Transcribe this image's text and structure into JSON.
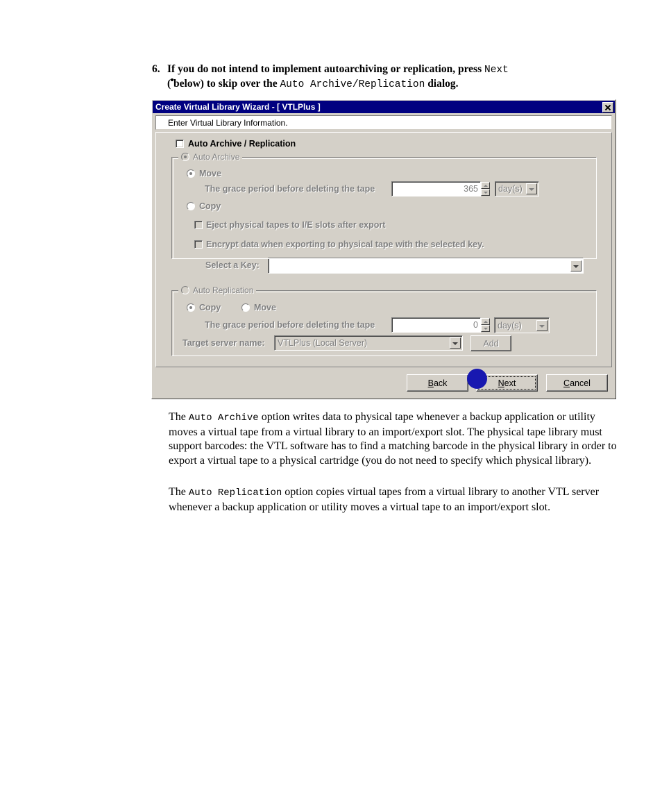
{
  "step": {
    "number": "6.",
    "line1_a": "If you do not intend to implement autoarchiving or replication, press ",
    "line1_mono": "Next",
    "line2_a": "(",
    "line2_b": " below) to skip over the ",
    "line2_mono": "Auto Archive/Replication",
    "line2_c": " dialog."
  },
  "dialog": {
    "title": "Create Virtual Library Wizard - [ VTLPlus ]",
    "close_icon": "close-icon",
    "subheader": "Enter Virtual Library Information.",
    "main_checkbox_label": "Auto Archive / Replication",
    "auto_archive": {
      "legend": "Auto Archive",
      "move_label": "Move",
      "copy_label": "Copy",
      "grace_label": "The grace period before deleting the tape",
      "grace_value": "365",
      "grace_unit": "day(s)",
      "eject_label": "Eject physical tapes to I/E slots after export",
      "encrypt_label": "Encrypt data when exporting to physical tape with the selected key.",
      "select_key_label": "Select a Key:",
      "select_key_value": ""
    },
    "auto_replication": {
      "legend": "Auto Replication",
      "copy_label": "Copy",
      "move_label": "Move",
      "grace_label": "The grace period before deleting the tape",
      "grace_value": "0",
      "grace_unit": "day(s)",
      "target_label": "Target server name:",
      "target_value": "VTLPlus (Local Server)",
      "add_label": "Add"
    },
    "buttons": {
      "back": "Back",
      "back_accel": "B",
      "next": "Next",
      "next_accel": "N",
      "cancel": "Cancel",
      "cancel_accel": "C"
    }
  },
  "annotation": {
    "circle_color": "#1818b0"
  },
  "paragraphs": {
    "p1_a": "The ",
    "p1_mono": "Auto Archive",
    "p1_b": " option writes data to physical tape whenever a backup application or utility moves a virtual tape from a virtual library to an import/export slot. The physical tape library must support barcodes: the VTL software has to find a matching barcode in the physical library in order to export a virtual tape to a physical cartridge (you do not need to specify which physical library).",
    "p2_a": "The ",
    "p2_mono": "Auto Replication",
    "p2_b": " option copies virtual tapes from a virtual library to another VTL server whenever a backup application or utility moves a virtual tape to an import/export slot."
  }
}
